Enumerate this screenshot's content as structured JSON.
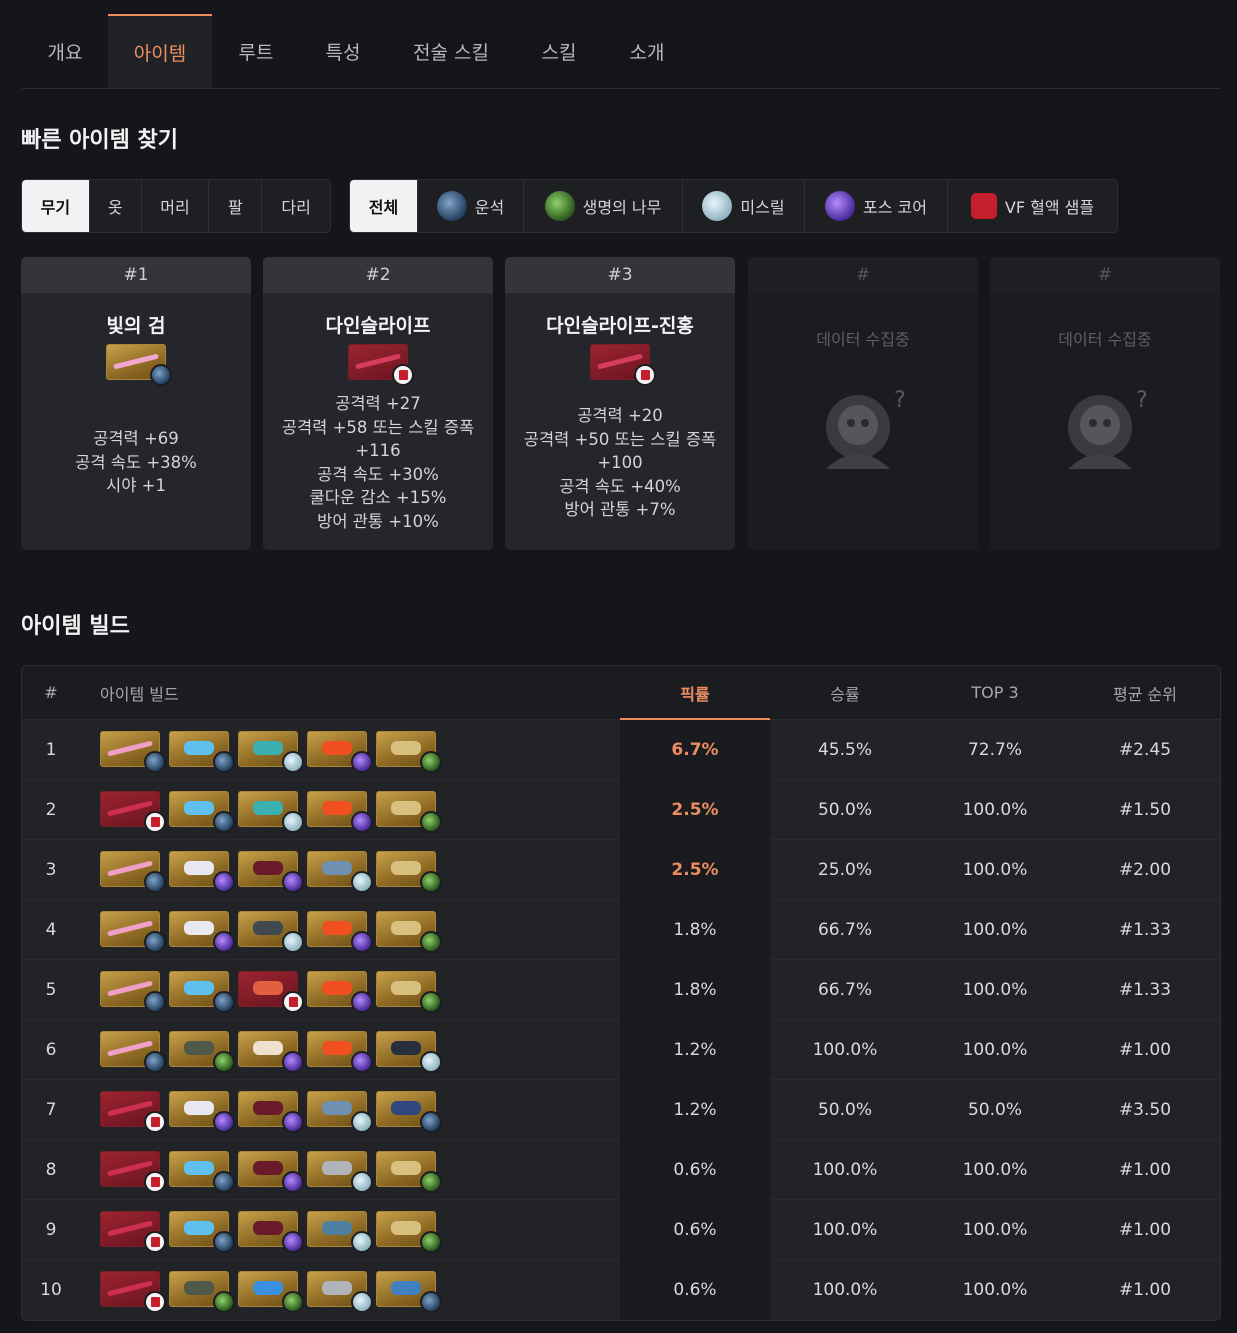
{
  "tabs": [
    "개요",
    "아이템",
    "루트",
    "특성",
    "전술 스킬",
    "스킬",
    "소개"
  ],
  "active_tab": 1,
  "quick_find": {
    "title": "빠른 아이템 찾기",
    "slots": [
      "무기",
      "옷",
      "머리",
      "팔",
      "다리"
    ],
    "materials": [
      {
        "label": "전체",
        "icon": ""
      },
      {
        "label": "운석",
        "icon": "meteorite-icon"
      },
      {
        "label": "생명의 나무",
        "icon": "tree-of-life-icon"
      },
      {
        "label": "미스릴",
        "icon": "mithril-icon"
      },
      {
        "label": "포스 코어",
        "icon": "force-core-icon"
      },
      {
        "label": "VF 혈액 샘플",
        "icon": "vf-blood-sample-icon"
      }
    ]
  },
  "top_items": [
    {
      "rank": "#1",
      "name": "빛의 검",
      "stats": [
        "공격력 +69",
        "공격 속도 +38%",
        "시야 +1"
      ],
      "frame": "gold",
      "badge": "b-met"
    },
    {
      "rank": "#2",
      "name": "다인슬라이프",
      "stats": [
        "공격력 +27",
        "공격력 +58 또는 스킬 증폭",
        "+116",
        "공격 속도 +30%",
        "쿨다운 감소 +15%",
        "방어 관통 +10%"
      ],
      "frame": "red",
      "badge": "b-vf"
    },
    {
      "rank": "#3",
      "name": "다인슬라이프-진홍",
      "stats": [
        "공격력 +20",
        "공격력 +50 또는 스킬 증폭",
        "+100",
        "공격 속도 +40%",
        "방어 관통 +7%"
      ],
      "frame": "red",
      "badge": "b-vf"
    },
    {
      "rank": "#",
      "collecting": "데이터 수집중"
    },
    {
      "rank": "#",
      "collecting": "데이터 수집중"
    }
  ],
  "builds": {
    "title": "아이템 빌드",
    "columns": [
      "#",
      "아이템 빌드",
      "픽률",
      "승률",
      "TOP 3",
      "평균 순위"
    ],
    "rows": [
      {
        "n": "1",
        "pick": "6.7%",
        "win": "45.5%",
        "top3": "72.7%",
        "avg": "#2.45",
        "hi": true,
        "items": [
          [
            "gold",
            "b-met",
            "#f0a0c8"
          ],
          [
            "gold",
            "b-met",
            "#5fc0f0"
          ],
          [
            "gold",
            "b-mith",
            "#3ab0b0"
          ],
          [
            "gold",
            "b-core",
            "#f05020"
          ],
          [
            "gold",
            "b-tree",
            "#d8c080"
          ]
        ]
      },
      {
        "n": "2",
        "pick": "2.5%",
        "win": "50.0%",
        "top3": "100.0%",
        "avg": "#1.50",
        "hi": true,
        "items": [
          [
            "red",
            "b-vf",
            "#d03050"
          ],
          [
            "gold",
            "b-met",
            "#5fc0f0"
          ],
          [
            "gold",
            "b-mith",
            "#3ab0b0"
          ],
          [
            "gold",
            "b-core",
            "#f05020"
          ],
          [
            "gold",
            "b-tree",
            "#d8c080"
          ]
        ]
      },
      {
        "n": "3",
        "pick": "2.5%",
        "win": "25.0%",
        "top3": "100.0%",
        "avg": "#2.00",
        "hi": true,
        "items": [
          [
            "gold",
            "b-met",
            "#f0a0c8"
          ],
          [
            "gold",
            "b-core",
            "#e8e8f0"
          ],
          [
            "gold",
            "b-core",
            "#6a1a2a"
          ],
          [
            "gold",
            "b-mith",
            "#7090b0"
          ],
          [
            "gold",
            "b-tree",
            "#d8c080"
          ]
        ]
      },
      {
        "n": "4",
        "pick": "1.8%",
        "win": "66.7%",
        "top3": "100.0%",
        "avg": "#1.33",
        "hi": false,
        "items": [
          [
            "gold",
            "b-met",
            "#f0a0c8"
          ],
          [
            "gold",
            "b-core",
            "#e8e8f0"
          ],
          [
            "gold",
            "b-mith",
            "#404850"
          ],
          [
            "gold",
            "b-core",
            "#f05020"
          ],
          [
            "gold",
            "b-tree",
            "#d8c080"
          ]
        ]
      },
      {
        "n": "5",
        "pick": "1.8%",
        "win": "66.7%",
        "top3": "100.0%",
        "avg": "#1.33",
        "hi": false,
        "items": [
          [
            "gold",
            "b-met",
            "#f0a0c8"
          ],
          [
            "gold",
            "b-met",
            "#5fc0f0"
          ],
          [
            "red",
            "b-vf",
            "#e06040"
          ],
          [
            "gold",
            "b-core",
            "#f05020"
          ],
          [
            "gold",
            "b-tree",
            "#d8c080"
          ]
        ]
      },
      {
        "n": "6",
        "pick": "1.2%",
        "win": "100.0%",
        "top3": "100.0%",
        "avg": "#1.00",
        "hi": false,
        "items": [
          [
            "gold",
            "b-met",
            "#f0a0c8"
          ],
          [
            "gold",
            "b-tree",
            "#505848"
          ],
          [
            "gold",
            "b-core",
            "#f0e0d0"
          ],
          [
            "gold",
            "b-core",
            "#f05020"
          ],
          [
            "gold",
            "b-mith",
            "#283040"
          ]
        ]
      },
      {
        "n": "7",
        "pick": "1.2%",
        "win": "50.0%",
        "top3": "50.0%",
        "avg": "#3.50",
        "hi": false,
        "items": [
          [
            "red",
            "b-vf",
            "#d03050"
          ],
          [
            "gold",
            "b-core",
            "#e8e8f0"
          ],
          [
            "gold",
            "b-core",
            "#6a1a2a"
          ],
          [
            "gold",
            "b-mith",
            "#7090b0"
          ],
          [
            "gold",
            "b-met",
            "#304880"
          ]
        ]
      },
      {
        "n": "8",
        "pick": "0.6%",
        "win": "100.0%",
        "top3": "100.0%",
        "avg": "#1.00",
        "hi": false,
        "items": [
          [
            "red",
            "b-vf",
            "#d03050"
          ],
          [
            "gold",
            "b-met",
            "#5fc0f0"
          ],
          [
            "gold",
            "b-core",
            "#6a1a2a"
          ],
          [
            "gold",
            "b-mith",
            "#b0b4b8"
          ],
          [
            "gold",
            "b-tree",
            "#d8c080"
          ]
        ]
      },
      {
        "n": "9",
        "pick": "0.6%",
        "win": "100.0%",
        "top3": "100.0%",
        "avg": "#1.00",
        "hi": false,
        "items": [
          [
            "red",
            "b-vf",
            "#d03050"
          ],
          [
            "gold",
            "b-met",
            "#5fc0f0"
          ],
          [
            "gold",
            "b-core",
            "#6a1a2a"
          ],
          [
            "gold",
            "b-mith",
            "#5080a0"
          ],
          [
            "gold",
            "b-tree",
            "#d8c080"
          ]
        ]
      },
      {
        "n": "10",
        "pick": "0.6%",
        "win": "100.0%",
        "top3": "100.0%",
        "avg": "#1.00",
        "hi": false,
        "items": [
          [
            "red",
            "b-vf",
            "#d03050"
          ],
          [
            "gold",
            "b-tree",
            "#505848"
          ],
          [
            "gold",
            "b-tree",
            "#3a90e0"
          ],
          [
            "gold",
            "b-mith",
            "#b0b4b8"
          ],
          [
            "gold",
            "b-met",
            "#4080c0"
          ]
        ]
      }
    ]
  },
  "colors": {
    "accent": "#ec8e62",
    "bg": "#151619",
    "panel": "#25262b"
  }
}
